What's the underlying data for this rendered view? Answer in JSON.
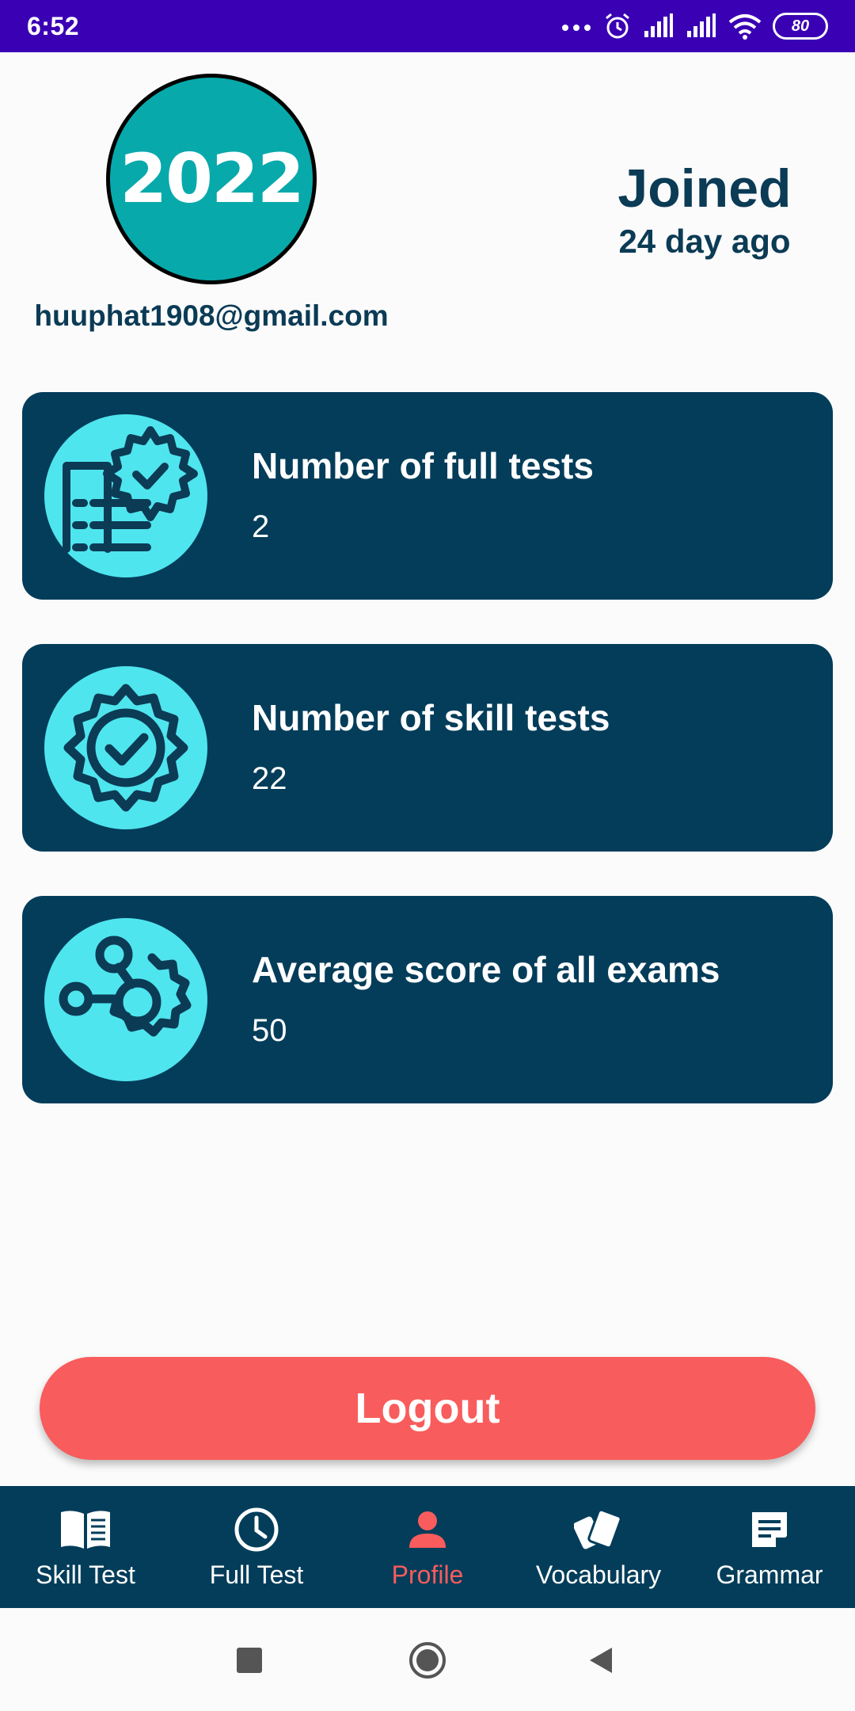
{
  "status_bar": {
    "time": "6:52",
    "battery": "80"
  },
  "profile": {
    "avatar_text": "2022",
    "email": "huuphat1908@gmail.com",
    "joined_title": "Joined",
    "joined_sub": "24 day ago"
  },
  "stats": [
    {
      "title": "Number of full tests",
      "value": "2",
      "icon": "document-gear-check-icon"
    },
    {
      "title": "Number of skill tests",
      "value": "22",
      "icon": "gear-check-icon"
    },
    {
      "title": "Average score of all exams",
      "value": "50",
      "icon": "network-gear-icon"
    }
  ],
  "logout_label": "Logout",
  "bottom_nav": [
    {
      "label": "Skill Test",
      "icon": "book-icon",
      "active": false
    },
    {
      "label": "Full Test",
      "icon": "clock-icon",
      "active": false
    },
    {
      "label": "Profile",
      "icon": "person-icon",
      "active": true
    },
    {
      "label": "Vocabulary",
      "icon": "cards-icon",
      "active": false
    },
    {
      "label": "Grammar",
      "icon": "note-icon",
      "active": false
    }
  ],
  "colors": {
    "status_bar": "#3a00b4",
    "primary_dark": "#033d5a",
    "icon_bg": "#4fe5ee",
    "accent": "#f95c5c",
    "avatar_bg": "#08a9ab"
  }
}
